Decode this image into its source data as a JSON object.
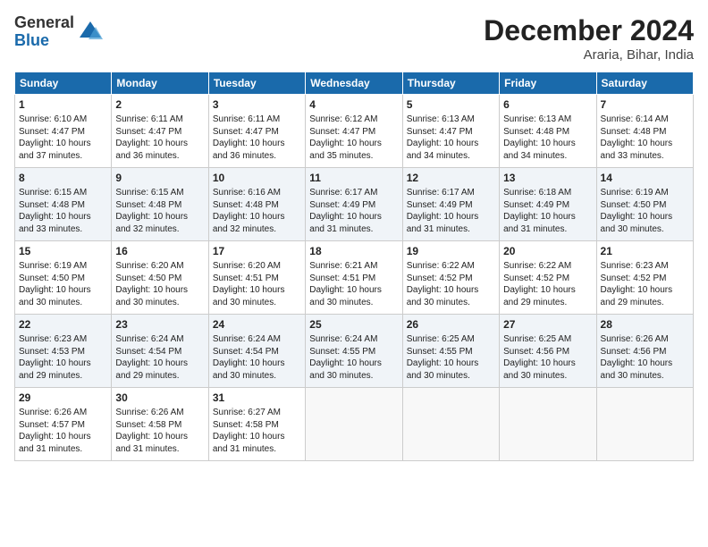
{
  "logo": {
    "general": "General",
    "blue": "Blue"
  },
  "title": {
    "month": "December 2024",
    "location": "Araria, Bihar, India"
  },
  "weekdays": [
    "Sunday",
    "Monday",
    "Tuesday",
    "Wednesday",
    "Thursday",
    "Friday",
    "Saturday"
  ],
  "weeks": [
    [
      {
        "day": "1",
        "info": "Sunrise: 6:10 AM\nSunset: 4:47 PM\nDaylight: 10 hours\nand 37 minutes."
      },
      {
        "day": "2",
        "info": "Sunrise: 6:11 AM\nSunset: 4:47 PM\nDaylight: 10 hours\nand 36 minutes."
      },
      {
        "day": "3",
        "info": "Sunrise: 6:11 AM\nSunset: 4:47 PM\nDaylight: 10 hours\nand 36 minutes."
      },
      {
        "day": "4",
        "info": "Sunrise: 6:12 AM\nSunset: 4:47 PM\nDaylight: 10 hours\nand 35 minutes."
      },
      {
        "day": "5",
        "info": "Sunrise: 6:13 AM\nSunset: 4:47 PM\nDaylight: 10 hours\nand 34 minutes."
      },
      {
        "day": "6",
        "info": "Sunrise: 6:13 AM\nSunset: 4:48 PM\nDaylight: 10 hours\nand 34 minutes."
      },
      {
        "day": "7",
        "info": "Sunrise: 6:14 AM\nSunset: 4:48 PM\nDaylight: 10 hours\nand 33 minutes."
      }
    ],
    [
      {
        "day": "8",
        "info": "Sunrise: 6:15 AM\nSunset: 4:48 PM\nDaylight: 10 hours\nand 33 minutes."
      },
      {
        "day": "9",
        "info": "Sunrise: 6:15 AM\nSunset: 4:48 PM\nDaylight: 10 hours\nand 32 minutes."
      },
      {
        "day": "10",
        "info": "Sunrise: 6:16 AM\nSunset: 4:48 PM\nDaylight: 10 hours\nand 32 minutes."
      },
      {
        "day": "11",
        "info": "Sunrise: 6:17 AM\nSunset: 4:49 PM\nDaylight: 10 hours\nand 31 minutes."
      },
      {
        "day": "12",
        "info": "Sunrise: 6:17 AM\nSunset: 4:49 PM\nDaylight: 10 hours\nand 31 minutes."
      },
      {
        "day": "13",
        "info": "Sunrise: 6:18 AM\nSunset: 4:49 PM\nDaylight: 10 hours\nand 31 minutes."
      },
      {
        "day": "14",
        "info": "Sunrise: 6:19 AM\nSunset: 4:50 PM\nDaylight: 10 hours\nand 30 minutes."
      }
    ],
    [
      {
        "day": "15",
        "info": "Sunrise: 6:19 AM\nSunset: 4:50 PM\nDaylight: 10 hours\nand 30 minutes."
      },
      {
        "day": "16",
        "info": "Sunrise: 6:20 AM\nSunset: 4:50 PM\nDaylight: 10 hours\nand 30 minutes."
      },
      {
        "day": "17",
        "info": "Sunrise: 6:20 AM\nSunset: 4:51 PM\nDaylight: 10 hours\nand 30 minutes."
      },
      {
        "day": "18",
        "info": "Sunrise: 6:21 AM\nSunset: 4:51 PM\nDaylight: 10 hours\nand 30 minutes."
      },
      {
        "day": "19",
        "info": "Sunrise: 6:22 AM\nSunset: 4:52 PM\nDaylight: 10 hours\nand 30 minutes."
      },
      {
        "day": "20",
        "info": "Sunrise: 6:22 AM\nSunset: 4:52 PM\nDaylight: 10 hours\nand 29 minutes."
      },
      {
        "day": "21",
        "info": "Sunrise: 6:23 AM\nSunset: 4:52 PM\nDaylight: 10 hours\nand 29 minutes."
      }
    ],
    [
      {
        "day": "22",
        "info": "Sunrise: 6:23 AM\nSunset: 4:53 PM\nDaylight: 10 hours\nand 29 minutes."
      },
      {
        "day": "23",
        "info": "Sunrise: 6:24 AM\nSunset: 4:54 PM\nDaylight: 10 hours\nand 29 minutes."
      },
      {
        "day": "24",
        "info": "Sunrise: 6:24 AM\nSunset: 4:54 PM\nDaylight: 10 hours\nand 30 minutes."
      },
      {
        "day": "25",
        "info": "Sunrise: 6:24 AM\nSunset: 4:55 PM\nDaylight: 10 hours\nand 30 minutes."
      },
      {
        "day": "26",
        "info": "Sunrise: 6:25 AM\nSunset: 4:55 PM\nDaylight: 10 hours\nand 30 minutes."
      },
      {
        "day": "27",
        "info": "Sunrise: 6:25 AM\nSunset: 4:56 PM\nDaylight: 10 hours\nand 30 minutes."
      },
      {
        "day": "28",
        "info": "Sunrise: 6:26 AM\nSunset: 4:56 PM\nDaylight: 10 hours\nand 30 minutes."
      }
    ],
    [
      {
        "day": "29",
        "info": "Sunrise: 6:26 AM\nSunset: 4:57 PM\nDaylight: 10 hours\nand 31 minutes."
      },
      {
        "day": "30",
        "info": "Sunrise: 6:26 AM\nSunset: 4:58 PM\nDaylight: 10 hours\nand 31 minutes."
      },
      {
        "day": "31",
        "info": "Sunrise: 6:27 AM\nSunset: 4:58 PM\nDaylight: 10 hours\nand 31 minutes."
      },
      {
        "day": "",
        "info": ""
      },
      {
        "day": "",
        "info": ""
      },
      {
        "day": "",
        "info": ""
      },
      {
        "day": "",
        "info": ""
      }
    ]
  ]
}
